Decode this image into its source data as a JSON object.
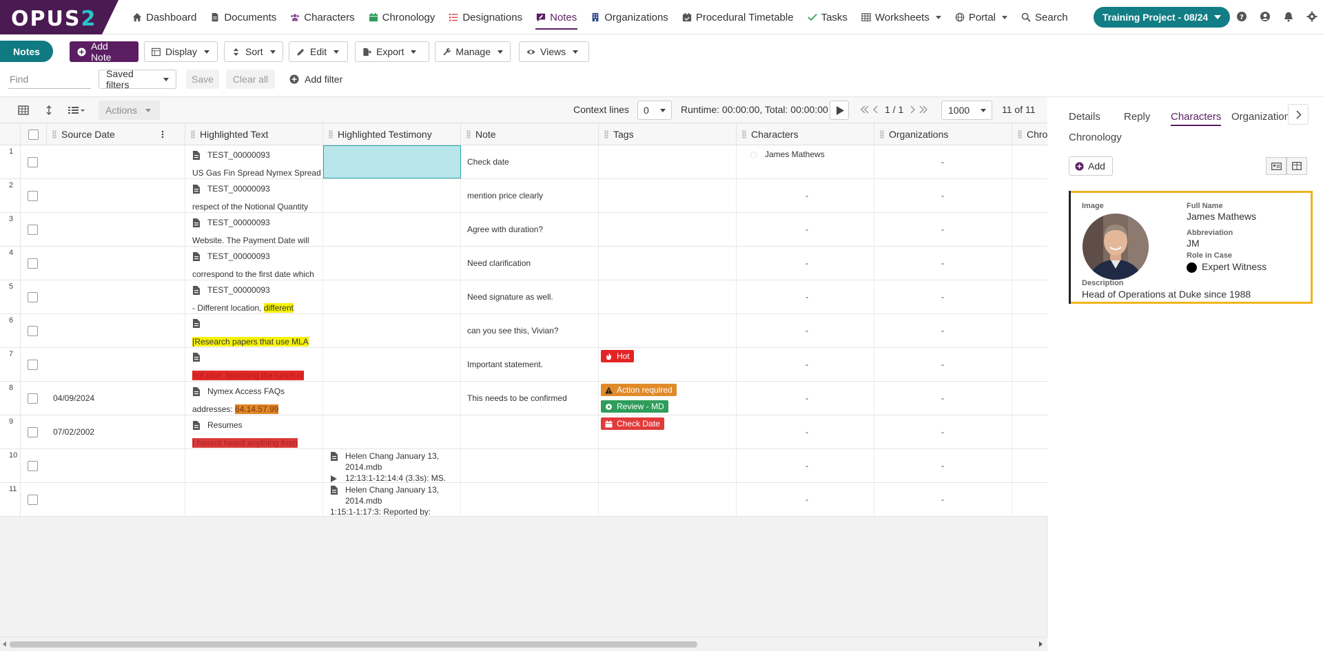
{
  "app": {
    "logo_opus": "OPUS",
    "logo_two": "2"
  },
  "nav": [
    {
      "label": "Dashboard",
      "icon": "home-icon"
    },
    {
      "label": "Documents",
      "icon": "document-icon"
    },
    {
      "label": "Characters",
      "icon": "users-icon"
    },
    {
      "label": "Chronology",
      "icon": "calendar-icon"
    },
    {
      "label": "Designations",
      "icon": "list-icon"
    },
    {
      "label": "Notes",
      "icon": "note-icon"
    },
    {
      "label": "Organizations",
      "icon": "building-icon"
    },
    {
      "label": "Procedural Timetable",
      "icon": "calendar-check-icon"
    },
    {
      "label": "Tasks",
      "icon": "check-icon"
    },
    {
      "label": "Worksheets",
      "icon": "table-icon"
    },
    {
      "label": "Portal",
      "icon": "globe-icon"
    },
    {
      "label": "Search",
      "icon": "search-icon"
    }
  ],
  "project": {
    "label": "Training Project - 08/24"
  },
  "colors": {
    "brand": "#5b1e63",
    "teal": "#127d84",
    "accent_yellow": "#f2b320"
  },
  "toolbar": {
    "section_label": "Notes",
    "add_note": "Add Note",
    "display": "Display",
    "sort": "Sort",
    "edit": "Edit",
    "export": "Export",
    "manage": "Manage",
    "views": "Views"
  },
  "filters": {
    "find_placeholder": "Find",
    "saved_filters": "Saved filters",
    "save": "Save",
    "clear_all": "Clear all",
    "add_filter": "Add filter"
  },
  "gridbar": {
    "actions": "Actions",
    "context_label": "Context lines",
    "context_value": "0",
    "runtime": "Runtime: 00:00:00, Total: 00:00:00",
    "page": "1 / 1",
    "per_page": "1000",
    "count": "11 of 11"
  },
  "columns": {
    "source_date": "Source Date",
    "highlighted_text": "Highlighted Text",
    "highlighted_testimony": "Highlighted Testimony",
    "note": "Note",
    "tags": "Tags",
    "characters": "Characters",
    "organizations": "Organizations",
    "chronology": "Chro"
  },
  "rows": [
    {
      "n": "1",
      "date": "",
      "doc": "TEST_00000093",
      "snippet": "US Gas Fin Spread Nymex Spread",
      "note": "Check date",
      "char": "James Mathews",
      "org": "-"
    },
    {
      "n": "2",
      "date": "",
      "doc": "TEST_00000093",
      "snippet": "respect of the Notional Quantity",
      "note": "mention price clearly",
      "char": "-",
      "org": "-"
    },
    {
      "n": "3",
      "date": "",
      "doc": "TEST_00000093",
      "snippet": "Website. The Payment Date will",
      "note": "Agree with duration?",
      "char": "-",
      "org": "-"
    },
    {
      "n": "4",
      "date": "",
      "doc": "TEST_00000093",
      "snippet": "correspond to the first date which",
      "note": "Need clarification",
      "char": "-",
      "org": "-"
    },
    {
      "n": "5",
      "date": "",
      "doc": "TEST_00000093",
      "snippet_pre": "- Different location, ",
      "snippet_hl": "different",
      "note": "Need signature as well.",
      "char": "-",
      "org": "-"
    },
    {
      "n": "6",
      "date": "",
      "doc": "",
      "snippet_hl": "[Research papers that use MLA",
      "note": "can you see this, Vivian?",
      "char": "-",
      "org": "-"
    },
    {
      "n": "7",
      "date": "",
      "doc": "",
      "snippet_hl": "hot clue: financing the lunch of",
      "note": "Important statement.",
      "tag1": "Hot",
      "char": "-",
      "org": "-"
    },
    {
      "n": "8",
      "date": "04/09/2024",
      "doc": "Nymex Access FAQs",
      "snippet_pre": "addresses: ",
      "snippet_hl": "64.14.57.99",
      "note": "This needs to be confirmed",
      "tag1": "Action required",
      "tag2": "Review - MD",
      "char": "-",
      "org": "-"
    },
    {
      "n": "9",
      "date": "07/02/2002",
      "doc": "Resumes",
      "snippet_hl": "I havent heard anything from",
      "note": "",
      "tag1": "Check Date",
      "char": "-",
      "org": "-"
    },
    {
      "n": "10",
      "date": "",
      "testi1": "Helen Chang January 13,",
      "testi2": "2014.mdb",
      "testi3": "12:13:1-12:14:4 (3.3s): MS.",
      "char": "-",
      "org": "-"
    },
    {
      "n": "11",
      "date": "",
      "testi1": "Helen Chang January 13,",
      "testi2": "2014.mdb",
      "testi3": "1:15:1-1:17:3: Reported by:",
      "char": "-",
      "org": "-"
    }
  ],
  "panel": {
    "tabs": [
      "Details",
      "Reply",
      "Characters",
      "Organizations",
      "Chronology"
    ],
    "active_tab": "Characters",
    "add": "Add",
    "card": {
      "image_label": "Image",
      "full_name_label": "Full Name",
      "full_name": "James Mathews",
      "abbr_label": "Abbreviation",
      "abbr": "JM",
      "role_label": "Role in Case",
      "role": "Expert Witness",
      "desc_label": "Description",
      "desc": "Head of Operations at Duke since 1988"
    }
  }
}
